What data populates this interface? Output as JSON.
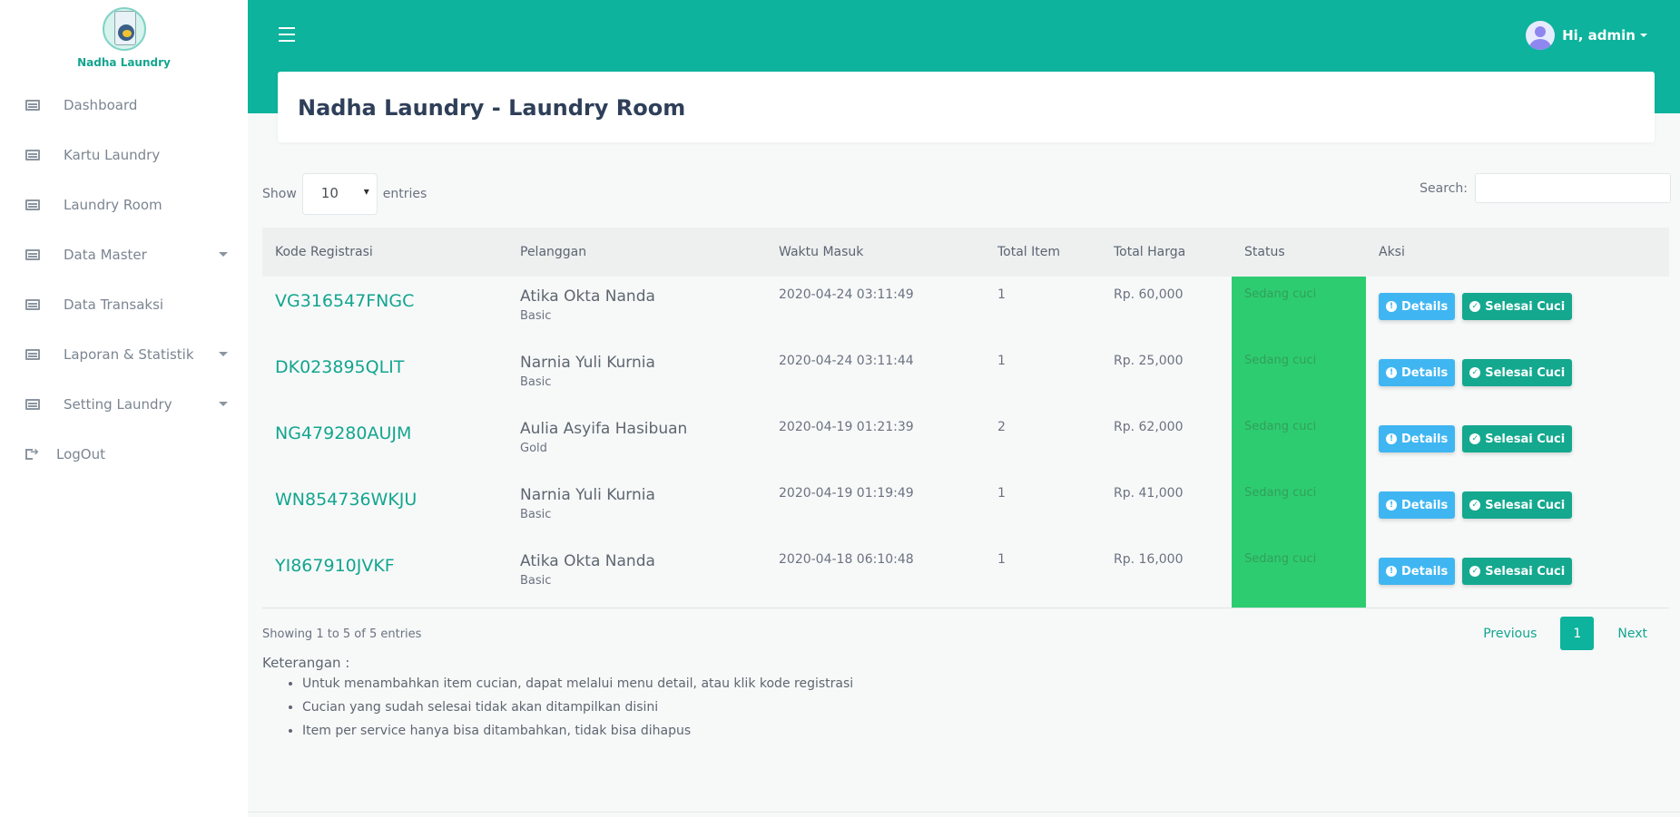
{
  "brand": {
    "name": "Nadha Laundry"
  },
  "sidebar": {
    "items": [
      {
        "label": "Dashboard",
        "icon": "list-icon",
        "has_caret": false
      },
      {
        "label": "Kartu Laundry",
        "icon": "list-icon",
        "has_caret": false
      },
      {
        "label": "Laundry Room",
        "icon": "list-icon",
        "has_caret": false
      },
      {
        "label": "Data Master",
        "icon": "list-icon",
        "has_caret": true
      },
      {
        "label": "Data Transaksi",
        "icon": "list-icon",
        "has_caret": false
      },
      {
        "label": "Laporan & Statistik",
        "icon": "list-icon",
        "has_caret": true
      },
      {
        "label": "Setting Laundry",
        "icon": "list-icon",
        "has_caret": true
      },
      {
        "label": "LogOut",
        "icon": "logout-icon",
        "has_caret": false
      }
    ]
  },
  "header": {
    "user_label": "Hi, admin"
  },
  "page": {
    "title": "Nadha Laundry - Laundry Room"
  },
  "table_controls": {
    "show_label": "Show",
    "entries_value": "10",
    "entries_label": "entries",
    "search_label": "Search:",
    "search_value": ""
  },
  "table": {
    "columns": [
      "Kode Registrasi",
      "Pelanggan",
      "Waktu Masuk",
      "Total Item",
      "Total Harga",
      "Status",
      "Aksi"
    ],
    "rows": [
      {
        "kode": "VG316547FNGC",
        "nama": "Atika Okta Nanda",
        "tipe": "Basic",
        "waktu": "2020-04-24 03:11:49",
        "total_item": "1",
        "total_harga": "Rp. 60,000",
        "status": "Sedang cuci"
      },
      {
        "kode": "DK023895QLIT",
        "nama": "Narnia Yuli Kurnia",
        "tipe": "Basic",
        "waktu": "2020-04-24 03:11:44",
        "total_item": "1",
        "total_harga": "Rp. 25,000",
        "status": "Sedang cuci"
      },
      {
        "kode": "NG479280AUJM",
        "nama": "Aulia Asyifa Hasibuan",
        "tipe": "Gold",
        "waktu": "2020-04-19 01:21:39",
        "total_item": "2",
        "total_harga": "Rp. 62,000",
        "status": "Sedang cuci"
      },
      {
        "kode": "WN854736WKJU",
        "nama": "Narnia Yuli Kurnia",
        "tipe": "Basic",
        "waktu": "2020-04-19 01:19:49",
        "total_item": "1",
        "total_harga": "Rp. 41,000",
        "status": "Sedang cuci"
      },
      {
        "kode": "YI867910JVKF",
        "nama": "Atika Okta Nanda",
        "tipe": "Basic",
        "waktu": "2020-04-18 06:10:48",
        "total_item": "1",
        "total_harga": "Rp. 16,000",
        "status": "Sedang cuci"
      }
    ],
    "actions": {
      "details": "Details",
      "selesai": "Selesai Cuci"
    }
  },
  "table_footer": {
    "info": "Showing 1 to 5 of 5 entries",
    "previous": "Previous",
    "current_page": "1",
    "next": "Next"
  },
  "notes": {
    "title": "Keterangan :",
    "items": [
      "Untuk menambahkan item cucian, dapat melalui menu detail, atau klik kode registrasi",
      "Cucian yang sudah selesai tidak akan ditampilkan disini",
      "Item per service hanya bisa ditambahkan, tidak bisa dihapus"
    ]
  },
  "colors": {
    "primary": "#0db39c",
    "status_bg": "#2ecc71",
    "info_button": "#3fb6f2",
    "success_button": "#14a88f"
  }
}
